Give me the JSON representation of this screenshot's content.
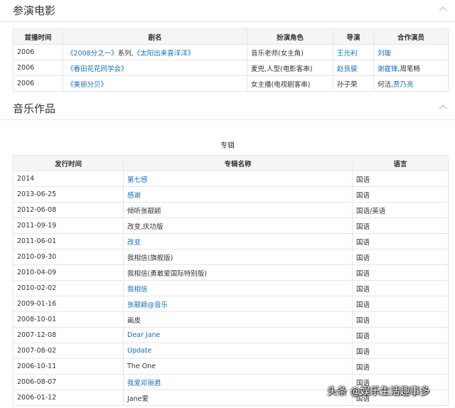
{
  "films_section": {
    "title": "参演电影",
    "headers": [
      "首播时间",
      "剧名",
      "扮演角色",
      "导演",
      "合作演员"
    ],
    "rows": [
      {
        "year": "2006",
        "title_a": "《2008分之一》",
        "title_sep": "系列,",
        "title_b": "《太阳出来喜洋洋》",
        "role": "音乐老师(女主角)",
        "director": "王光利",
        "costars": [
          {
            "name": "刘璇",
            "link": true
          }
        ]
      },
      {
        "year": "2006",
        "title_a": "《春田花花同学会》",
        "title_sep": "",
        "title_b": "",
        "role": "麦兜,人型(电影客串)",
        "director": "赵良骏",
        "costars": [
          {
            "name": "谢霆锋",
            "link": true
          },
          {
            "name": ",周笔畅",
            "link": false
          }
        ]
      },
      {
        "year": "2006",
        "title_a": "《美丽分贝》",
        "title_sep": "",
        "title_b": "",
        "role": "女主播(电视剧客串)",
        "director": "孙子荣",
        "costars": [
          {
            "name": "何洁,",
            "link": false
          },
          {
            "name": "贾乃亮",
            "link": true
          }
        ]
      }
    ]
  },
  "music_section": {
    "title": "音乐作品",
    "album_caption": "专辑",
    "headers": [
      "发行时间",
      "专辑名称",
      "语言"
    ],
    "rows": [
      {
        "date": "2014",
        "name": "第七感",
        "link": true,
        "lang": "国语"
      },
      {
        "date": "2013-06-25",
        "name": "感谢",
        "link": true,
        "lang": "国语"
      },
      {
        "date": "2012-06-08",
        "name": "倾听张靓颖",
        "link": false,
        "lang": "国语/英语"
      },
      {
        "date": "2011-09-19",
        "name": "改变,庆功版",
        "link": false,
        "lang": "国语"
      },
      {
        "date": "2011-06-01",
        "name": "改变",
        "link": true,
        "lang": "国语"
      },
      {
        "date": "2010-09-30",
        "name": "我相信(旗舰版)",
        "link": false,
        "lang": "国语"
      },
      {
        "date": "2010-04-09",
        "name": "我相信(勇敢爱国际特别版)",
        "link": false,
        "lang": "国语"
      },
      {
        "date": "2010-02-02",
        "name": "我相信",
        "link": true,
        "lang": "国语"
      },
      {
        "date": "2009-01-16",
        "name": "张靓颖@音乐",
        "link": true,
        "lang": "国语"
      },
      {
        "date": "2008-10-01",
        "name": "画皮",
        "link": false,
        "lang": "国语"
      },
      {
        "date": "2007-12-08",
        "name": "Dear Jane",
        "link": true,
        "lang": "国语"
      },
      {
        "date": "2007-08-02",
        "name": "Update",
        "link": true,
        "lang": "国语"
      },
      {
        "date": "2006-10-11",
        "name": "The One",
        "link": false,
        "lang": "国语"
      },
      {
        "date": "2006-08-07",
        "name": "我爱邓丽君",
        "link": true,
        "lang": "国语"
      },
      {
        "date": "2006-01-12",
        "name": "Jane爱",
        "link": false,
        "lang": "国语"
      }
    ]
  },
  "watermark": "头条 @娱乐生活趣事多"
}
